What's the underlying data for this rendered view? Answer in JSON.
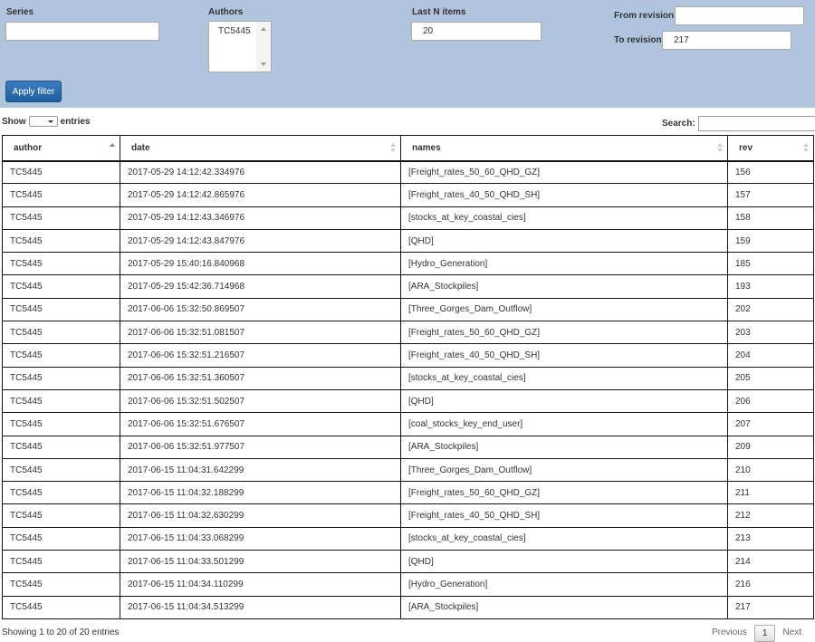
{
  "filters": {
    "series_label": "Series",
    "series_value": "",
    "authors_label": "Authors",
    "authors_options": [
      "TC5445"
    ],
    "last_n_label": "Last N items",
    "last_n_value": "20",
    "from_revision_label": "From revision",
    "from_revision_value": "",
    "to_revision_label": "To revision",
    "to_revision_value": "217",
    "apply_label": "Apply filter",
    "panel_color": "#b0c4de",
    "button_color": "#2a6aab"
  },
  "length": {
    "show_label": "Show",
    "entries_label": "entries",
    "selected": ""
  },
  "search": {
    "label": "Search:",
    "value": ""
  },
  "table": {
    "columns": [
      "author",
      "date",
      "names",
      "rev"
    ],
    "sorted_column": "author",
    "rows": [
      [
        "TC5445",
        "2017-05-29 14:12:42.334976",
        "[Freight_rates_50_60_QHD_GZ]",
        "156"
      ],
      [
        "TC5445",
        "2017-05-29 14:12:42.865976",
        "[Freight_rates_40_50_QHD_SH]",
        "157"
      ],
      [
        "TC5445",
        "2017-05-29 14:12:43.346976",
        "[stocks_at_key_coastal_cies]",
        "158"
      ],
      [
        "TC5445",
        "2017-05-29 14:12:43.847976",
        "[QHD]",
        "159"
      ],
      [
        "TC5445",
        "2017-05-29 15:40:16.840968",
        "[Hydro_Generation]",
        "185"
      ],
      [
        "TC5445",
        "2017-05-29 15:42:36.714968",
        "[ARA_Stockpiles]",
        "193"
      ],
      [
        "TC5445",
        "2017-06-06 15:32:50.869507",
        "[Three_Gorges_Dam_Outflow]",
        "202"
      ],
      [
        "TC5445",
        "2017-06-06 15:32:51.081507",
        "[Freight_rates_50_60_QHD_GZ]",
        "203"
      ],
      [
        "TC5445",
        "2017-06-06 15:32:51.216507",
        "[Freight_rates_40_50_QHD_SH]",
        "204"
      ],
      [
        "TC5445",
        "2017-06-06 15:32:51.360507",
        "[stocks_at_key_coastal_cies]",
        "205"
      ],
      [
        "TC5445",
        "2017-06-06 15:32:51.502507",
        "[QHD]",
        "206"
      ],
      [
        "TC5445",
        "2017-06-06 15:32:51.676507",
        "[coal_stocks_key_end_user]",
        "207"
      ],
      [
        "TC5445",
        "2017-06-06 15:32:51.977507",
        "[ARA_Stockpiles]",
        "209"
      ],
      [
        "TC5445",
        "2017-06-15 11:04:31.642299",
        "[Three_Gorges_Dam_Outflow]",
        "210"
      ],
      [
        "TC5445",
        "2017-06-15 11:04:32.188299",
        "[Freight_rates_50_60_QHD_GZ]",
        "211"
      ],
      [
        "TC5445",
        "2017-06-15 11:04:32.630299",
        "[Freight_rates_40_50_QHD_SH]",
        "212"
      ],
      [
        "TC5445",
        "2017-06-15 11:04:33.068299",
        "[stocks_at_key_coastal_cies]",
        "213"
      ],
      [
        "TC5445",
        "2017-06-15 11:04:33.501299",
        "[QHD]",
        "214"
      ],
      [
        "TC5445",
        "2017-06-15 11:04:34.110299",
        "[Hydro_Generation]",
        "216"
      ],
      [
        "TC5445",
        "2017-06-15 11:04:34.513299",
        "[ARA_Stockpiles]",
        "217"
      ]
    ]
  },
  "footer": {
    "info": "Showing 1 to 20 of 20 entries",
    "previous_label": "Previous",
    "current_page": "1",
    "next_label": "Next"
  }
}
